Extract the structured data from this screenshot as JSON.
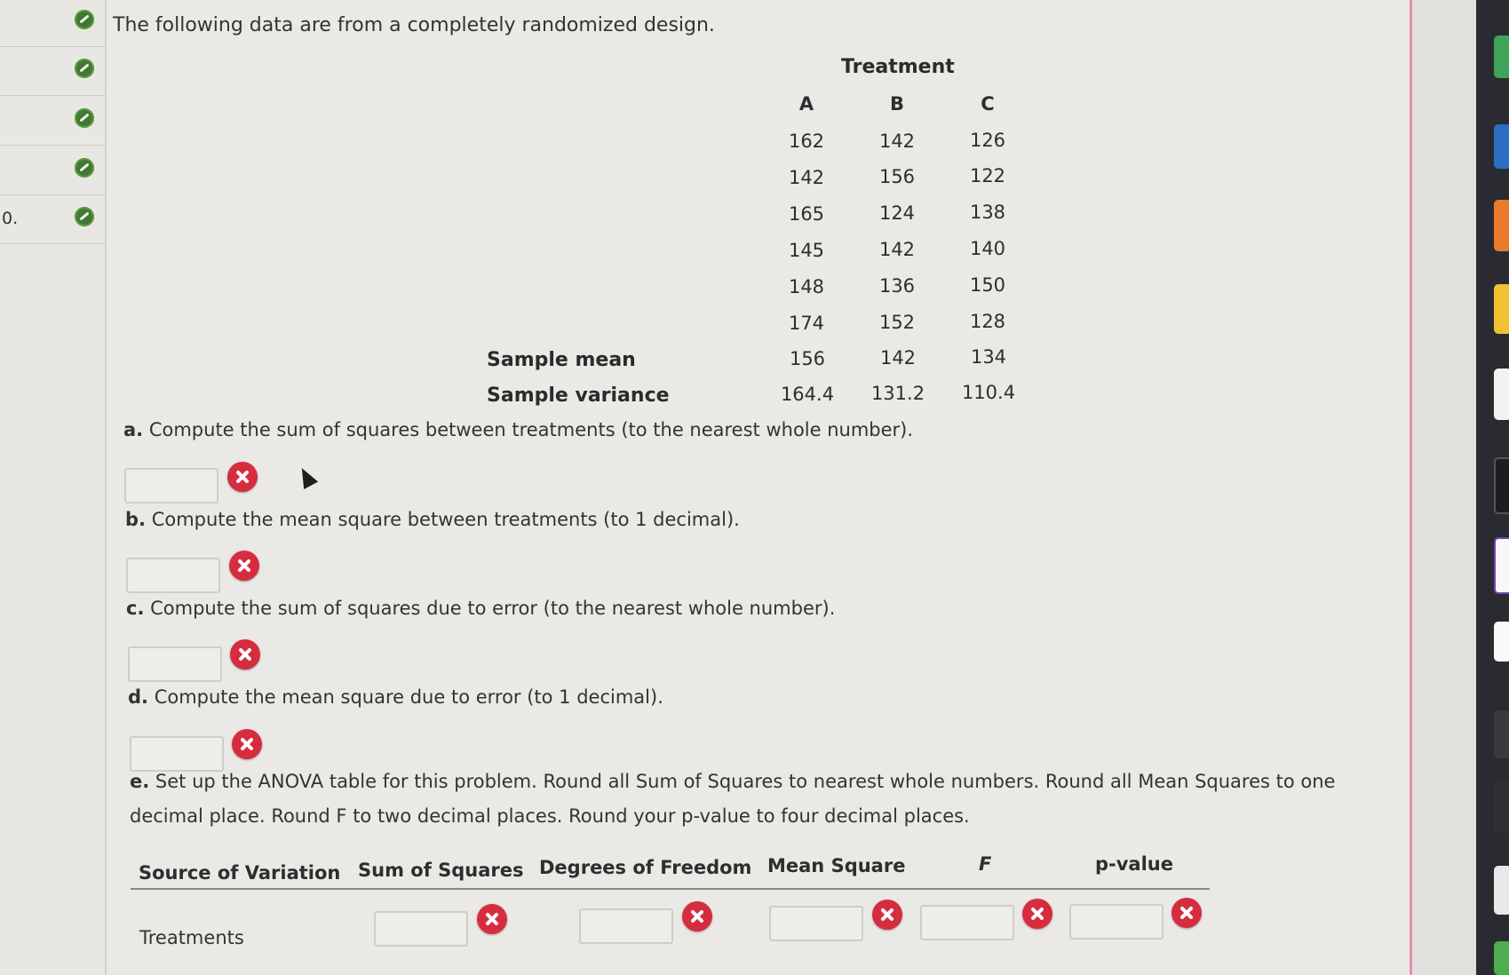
{
  "nav": {
    "items": [
      {
        "number": ""
      },
      {
        "number": ""
      },
      {
        "number": ""
      },
      {
        "number": ""
      },
      {
        "number": "0."
      }
    ]
  },
  "problem": {
    "intro": "The following data are from a completely randomized design.",
    "treatment_header": "Treatment",
    "columns": [
      "A",
      "B",
      "C"
    ],
    "rows": [
      [
        "162",
        "142",
        "126"
      ],
      [
        "142",
        "156",
        "122"
      ],
      [
        "165",
        "124",
        "138"
      ],
      [
        "145",
        "142",
        "140"
      ],
      [
        "148",
        "136",
        "150"
      ],
      [
        "174",
        "152",
        "128"
      ]
    ],
    "sample_mean_label": "Sample mean",
    "sample_mean": [
      "156",
      "142",
      "134"
    ],
    "sample_variance_label": "Sample variance",
    "sample_variance": [
      "164.4",
      "131.2",
      "110.4"
    ]
  },
  "questions": {
    "a": {
      "letter": "a.",
      "text": "Compute the sum of squares between treatments (to the nearest whole number).",
      "value": ""
    },
    "b": {
      "letter": "b.",
      "text": "Compute the mean square between treatments (to 1 decimal).",
      "value": ""
    },
    "c": {
      "letter": "c.",
      "text": "Compute the sum of squares due to error (to the nearest whole number).",
      "value": ""
    },
    "d": {
      "letter": "d.",
      "text": "Compute the mean square due to error (to 1 decimal).",
      "value": ""
    },
    "e": {
      "letter": "e.",
      "text_line1": "Set up the ANOVA table for this problem. Round all Sum of Squares to nearest whole numbers. Round all Mean Squares to one",
      "text_line2": "decimal place. Round F to two decimal places. Round your p-value to four decimal places."
    }
  },
  "anova": {
    "headers": [
      "Source of Variation",
      "Sum of Squares",
      "Degrees of Freedom",
      "Mean Square",
      "F",
      "p-value"
    ],
    "rows": [
      {
        "label": "Treatments",
        "values": [
          "",
          "",
          "",
          "",
          ""
        ]
      }
    ]
  },
  "colors": {
    "correct": "#3f7a2f",
    "incorrect": "#d62c3f",
    "accent_line": "#e58fb3"
  }
}
